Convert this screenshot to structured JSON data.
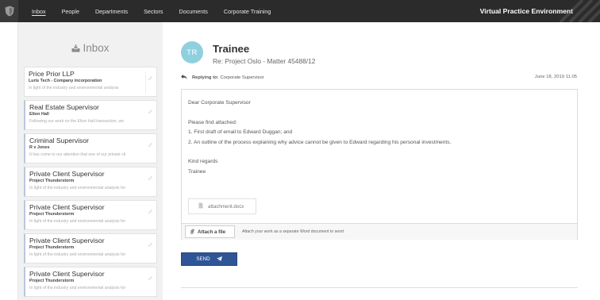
{
  "topbar": {
    "nav": [
      "Inbox",
      "People",
      "Departments",
      "Sectors",
      "Documents",
      "Corporate Training"
    ],
    "brand": "Virtual Practice Environment"
  },
  "inbox": {
    "title": "Inbox",
    "items": [
      {
        "sender": "Price Prior LLP",
        "subject": "Luris Tech - Company incorporation",
        "preview": "In light of the industry and environmental analysis"
      },
      {
        "sender": "Real Estate Supervisor",
        "subject": "Elton Hall",
        "preview": "Following our work on the Elton Hall transaction, we"
      },
      {
        "sender": "Criminal Supervisor",
        "subject": "R v Jones",
        "preview": "It has come to our attention that one of our private cli"
      },
      {
        "sender": "Private Client Supervisor",
        "subject": "Project Thunderstorm",
        "preview": "In light of the industry and environmental analysis for"
      },
      {
        "sender": "Private Client Supervisor",
        "subject": "Project Thunderstorm",
        "preview": "In light of the industry and environmental analysis for"
      },
      {
        "sender": "Private Client Supervisor",
        "subject": "Project Thunderstorm",
        "preview": "In light of the industry and environmental analysis for"
      },
      {
        "sender": "Private Client Supervisor",
        "subject": "Project Thunderstorm",
        "preview": "In light of the industry and environmental analysis for"
      }
    ]
  },
  "message": {
    "avatar_initials": "TR",
    "from": "Trainee",
    "subject": "Re: Project Oslo - Matter 45488/12",
    "replying_label": "Replying to:",
    "replying_to": "Corporate Supervisor",
    "date": "June 18, 2019 11.05",
    "body": [
      "Dear Corporate Supervisor",
      "",
      "Please find attached:",
      "1. First draft of email to Edward Duggan; and",
      "2. An outline of the process explaining why advice cannot be given to Edward regarding his personal investments.",
      "",
      "Kind regards",
      "Trainee"
    ],
    "attachment": "attachment.docx",
    "attach_button": "Attach a file",
    "attach_hint": "Attach your work as a separate Word document to send",
    "send_label": "SEND"
  },
  "colors": {
    "accent": "#2f5597",
    "avatar": "#8fd0df",
    "topbar": "#2b2b2b"
  }
}
